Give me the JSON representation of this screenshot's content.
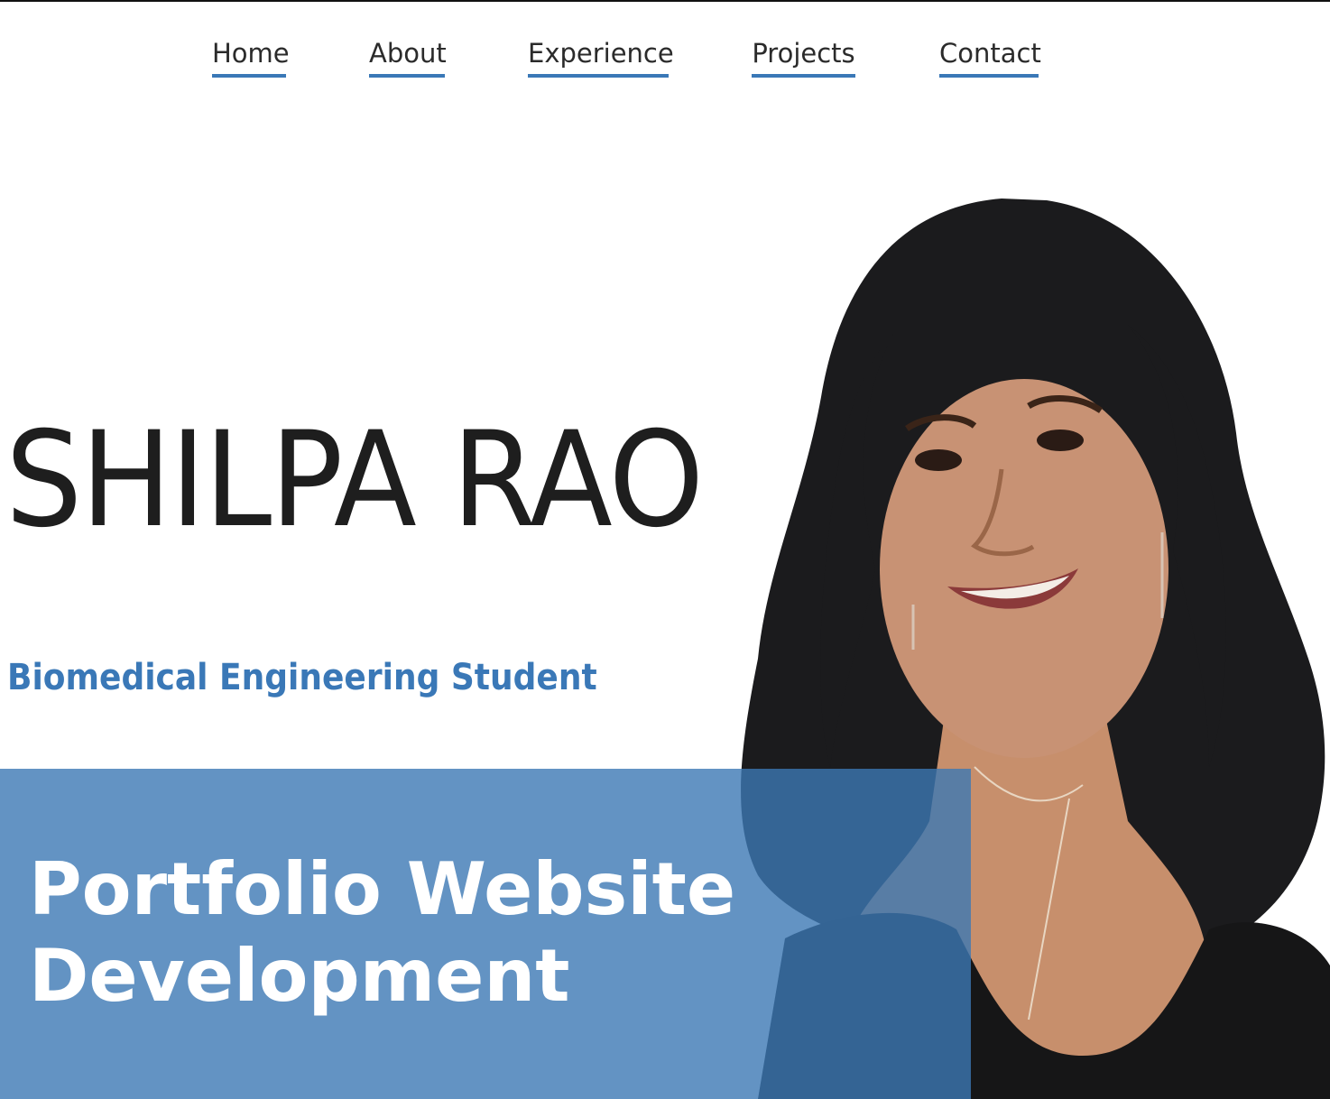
{
  "nav": {
    "items": [
      {
        "label": "Home"
      },
      {
        "label": "About"
      },
      {
        "label": "Experience"
      },
      {
        "label": "Projects"
      },
      {
        "label": "Contact"
      }
    ]
  },
  "hero": {
    "name": "SHILPA RAO",
    "subtitle": "Biomedical Engineering Student"
  },
  "banner": {
    "line1": "Portfolio Website",
    "line2": "Development"
  },
  "colors": {
    "accent": "#3a78b7",
    "banner": "#3c78b4",
    "text": "#1e1e1e"
  }
}
